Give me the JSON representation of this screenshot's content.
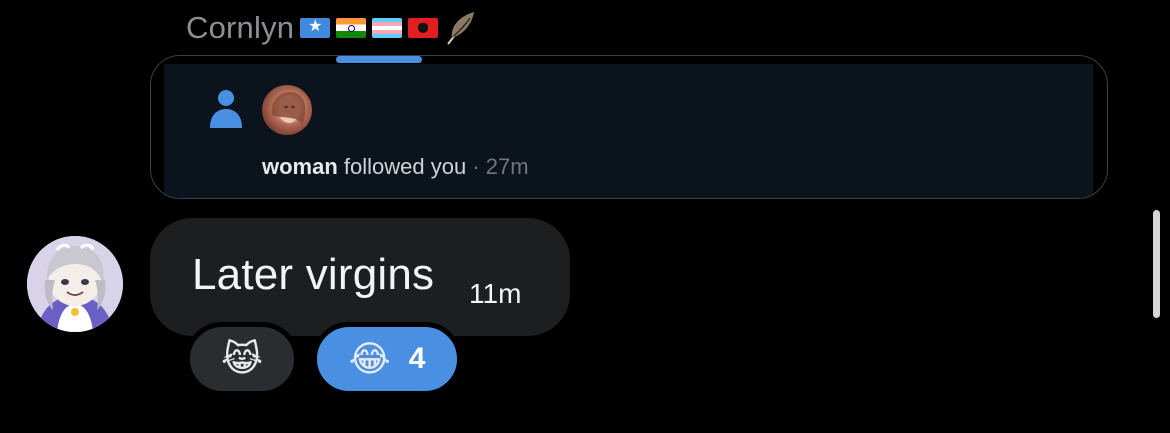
{
  "header": {
    "sender_name": "Cornlyn",
    "flags": [
      "somalia-flag",
      "india-flag",
      "transgender-flag",
      "albania-flag"
    ],
    "trailing_icon": "feather-icon"
  },
  "quoted_notification": {
    "icon": "person-icon",
    "username": "woman",
    "action": " followed you",
    "time": " · 27m"
  },
  "message": {
    "text": "Later virgins",
    "time": "11m"
  },
  "reactions": [
    {
      "emoji": "😹",
      "count": ""
    },
    {
      "emoji": "😂",
      "count": "4"
    }
  ],
  "colors": {
    "accent": "#4a90e2",
    "bubble": "#1c1e20",
    "background": "#000000"
  }
}
